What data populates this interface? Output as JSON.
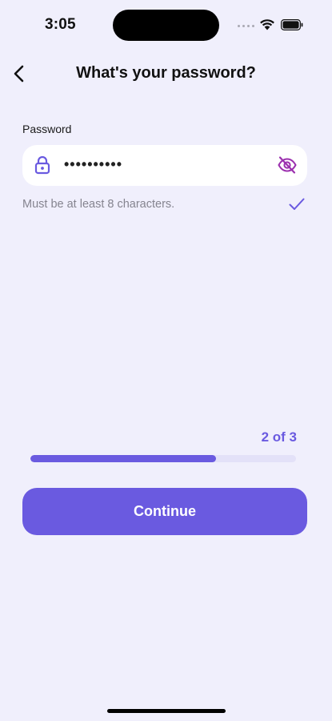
{
  "status_bar": {
    "time": "3:05"
  },
  "header": {
    "title": "What's your password?",
    "back_icon": "chevron-left-icon"
  },
  "password_field": {
    "label": "Password",
    "value": "••••••••••",
    "leading_icon": "lock-icon",
    "trailing_icon": "eye-off-icon",
    "hint": "Must be at least 8 characters.",
    "hint_icon": "checkmark-icon"
  },
  "progress": {
    "label": "2 of 3",
    "fraction": 0.7
  },
  "actions": {
    "continue_label": "Continue"
  },
  "colors": {
    "background": "#F0EFFC",
    "accent": "#6A5AE0",
    "accent_alt": "#9B2FAE",
    "track": "#E3E1F8",
    "hint_text": "#85848F"
  }
}
